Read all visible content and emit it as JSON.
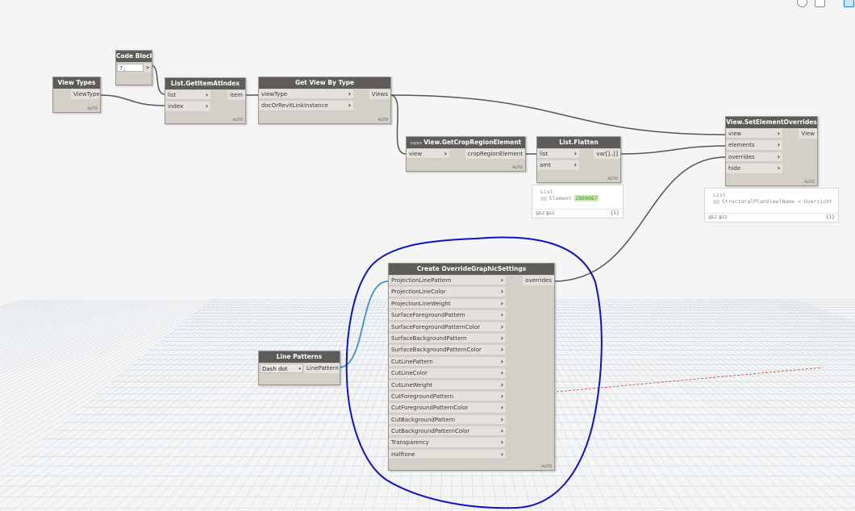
{
  "toolbar": {
    "icons": [
      "zoom-icon",
      "fit-icon",
      "layout-icon"
    ],
    "accent": "#1e7fd8"
  },
  "colors": {
    "wire": "#555555",
    "wire_selected": "#3b8fd6",
    "annotation": "#1111cc",
    "node_header": "#5e5c58",
    "node_body": "#d4d0c8"
  },
  "nodes": {
    "view_types": {
      "title": "View Types",
      "out": "ViewType",
      "footer": "AUTO"
    },
    "code_block": {
      "title": "Code Block",
      "code": "7;",
      "out": ">"
    },
    "get_item": {
      "title": "List.GetItemAtIndex",
      "in1": "list",
      "in2": "index",
      "out": "item",
      "footer": "AUTO"
    },
    "get_view": {
      "title": "Get View By Type",
      "in1": "viewType",
      "in2": "docOrRevitLinkInstance",
      "out": "Views",
      "footer": "AUTO"
    },
    "crop_region": {
      "badge": "rhythm",
      "title": "View.GetCropRegionElement",
      "in1": "view",
      "out": "cropRegionElement",
      "footer": "AUTO"
    },
    "flatten": {
      "title": "List.Flatten",
      "in1": "list",
      "in2": "amt",
      "out": "var[]..[]",
      "footer": "AUTO"
    },
    "overrides_node": {
      "title": "View.SetElementOverrides",
      "in1": "view",
      "in2": "elements",
      "in3": "overrides",
      "in4": "hide",
      "out": "View",
      "footer": "AUTO"
    },
    "line_patterns": {
      "title": "Line Patterns",
      "selected": "Dash dot",
      "out": "LinePattern"
    },
    "create_ogs": {
      "title": "Create OverrideGraphicSettings",
      "out": "overrides",
      "footer": "AUTO",
      "inputs": [
        "ProjectionLinePattern",
        "ProjectionLineColor",
        "ProjectionLineWeight",
        "SurfaceForegroundPattern",
        "SurfaceForegroundPatternColor",
        "SurfaceBackgroundPattern",
        "SurfaceBackgroundPatternColor",
        "CutLinePattern",
        "CutLineColor",
        "CutLineWeight",
        "CutForegroundPattern",
        "CutForegroundPatternColor",
        "CutBackgroundPattern",
        "CutBackgroundPatternColor",
        "Transparency",
        "Halftone"
      ]
    }
  },
  "previews": {
    "flatten": {
      "l1": "List",
      "l2": "Element",
      "value": "2899967",
      "foot_left": "@L2 @L1",
      "foot_right": "{1}"
    },
    "overrides": {
      "l1": "List",
      "l2": "StructuralPlanView(Name = Overzicht :",
      "foot_left": "@L2 @L1",
      "foot_right": "{1}"
    }
  }
}
